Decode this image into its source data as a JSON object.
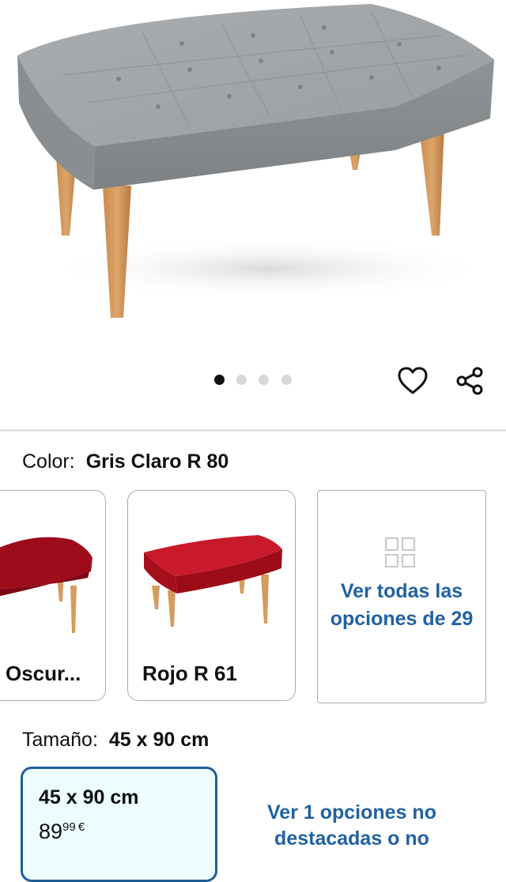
{
  "carousel": {
    "total_images": 4,
    "active_index": 0
  },
  "color": {
    "label": "Color:",
    "selected_value": "Gris Claro R 80",
    "options": [
      {
        "name": "Oscur...",
        "swatch_color": "#9e0c1c"
      },
      {
        "name": "Rojo R 61",
        "swatch_color": "#b41423"
      }
    ],
    "see_all_text": "Ver todas las opciones de 29"
  },
  "size": {
    "label": "Tamaño:",
    "selected_value": "45 x 90 cm",
    "card": {
      "title": "45 x 90 cm",
      "price_whole": "89",
      "price_fraction": "99",
      "currency": "€"
    },
    "more_options_text": "Ver 1 opciones no destacadas o no"
  },
  "colors": {
    "link": "#2162a1",
    "selected_border": "#1e5f99",
    "selected_bg": "#edfdff"
  }
}
